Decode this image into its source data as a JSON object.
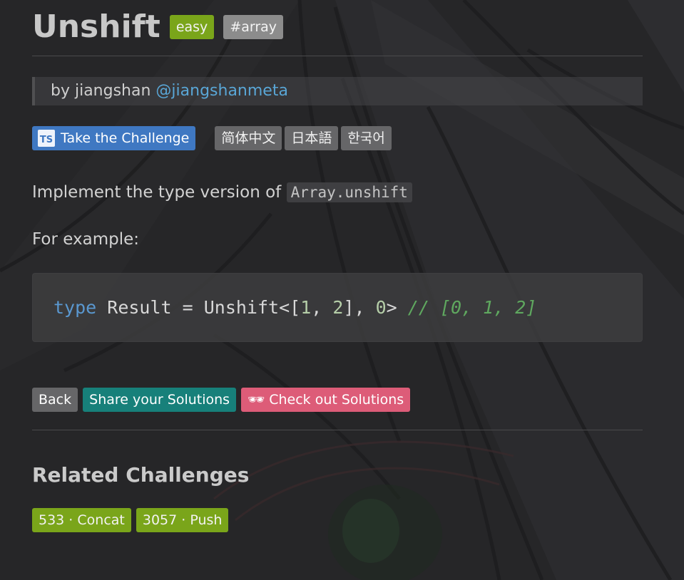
{
  "challenge": {
    "title": "Unshift",
    "difficulty": "easy",
    "tag": "#array"
  },
  "author": {
    "prefix": "by jiangshan",
    "handle": "@jiangshanmeta"
  },
  "buttons": {
    "take_challenge": "Take the Challenge",
    "ts_icon_text": "TS",
    "languages": [
      "简体中文",
      "日本語",
      "한국어"
    ]
  },
  "description": {
    "text": "Implement the type version of ",
    "code": "Array.unshift",
    "example_label": "For example:"
  },
  "code_example": {
    "keyword": "type",
    "name": " Result = Unshift<[",
    "n1": "1",
    "sep1": ", ",
    "n2": "2",
    "sep2": "], ",
    "n3": "0",
    "close": "> ",
    "comment": "// [0, 1, 2]"
  },
  "actions": {
    "back": "Back",
    "share": "Share your Solutions",
    "check_icon": "🕶",
    "check": "Check out Solutions"
  },
  "related": {
    "title": "Related Challenges",
    "items": [
      "533 · Concat",
      "3057 · Push"
    ]
  },
  "colors": {
    "background": "#242426",
    "easy_badge": "#7aa51a",
    "topic_badge": "#8c8c8c",
    "primary_button": "#3f78c2",
    "share_button": "#17807a",
    "check_button": "#dd5c78",
    "link": "#59a6d6"
  }
}
